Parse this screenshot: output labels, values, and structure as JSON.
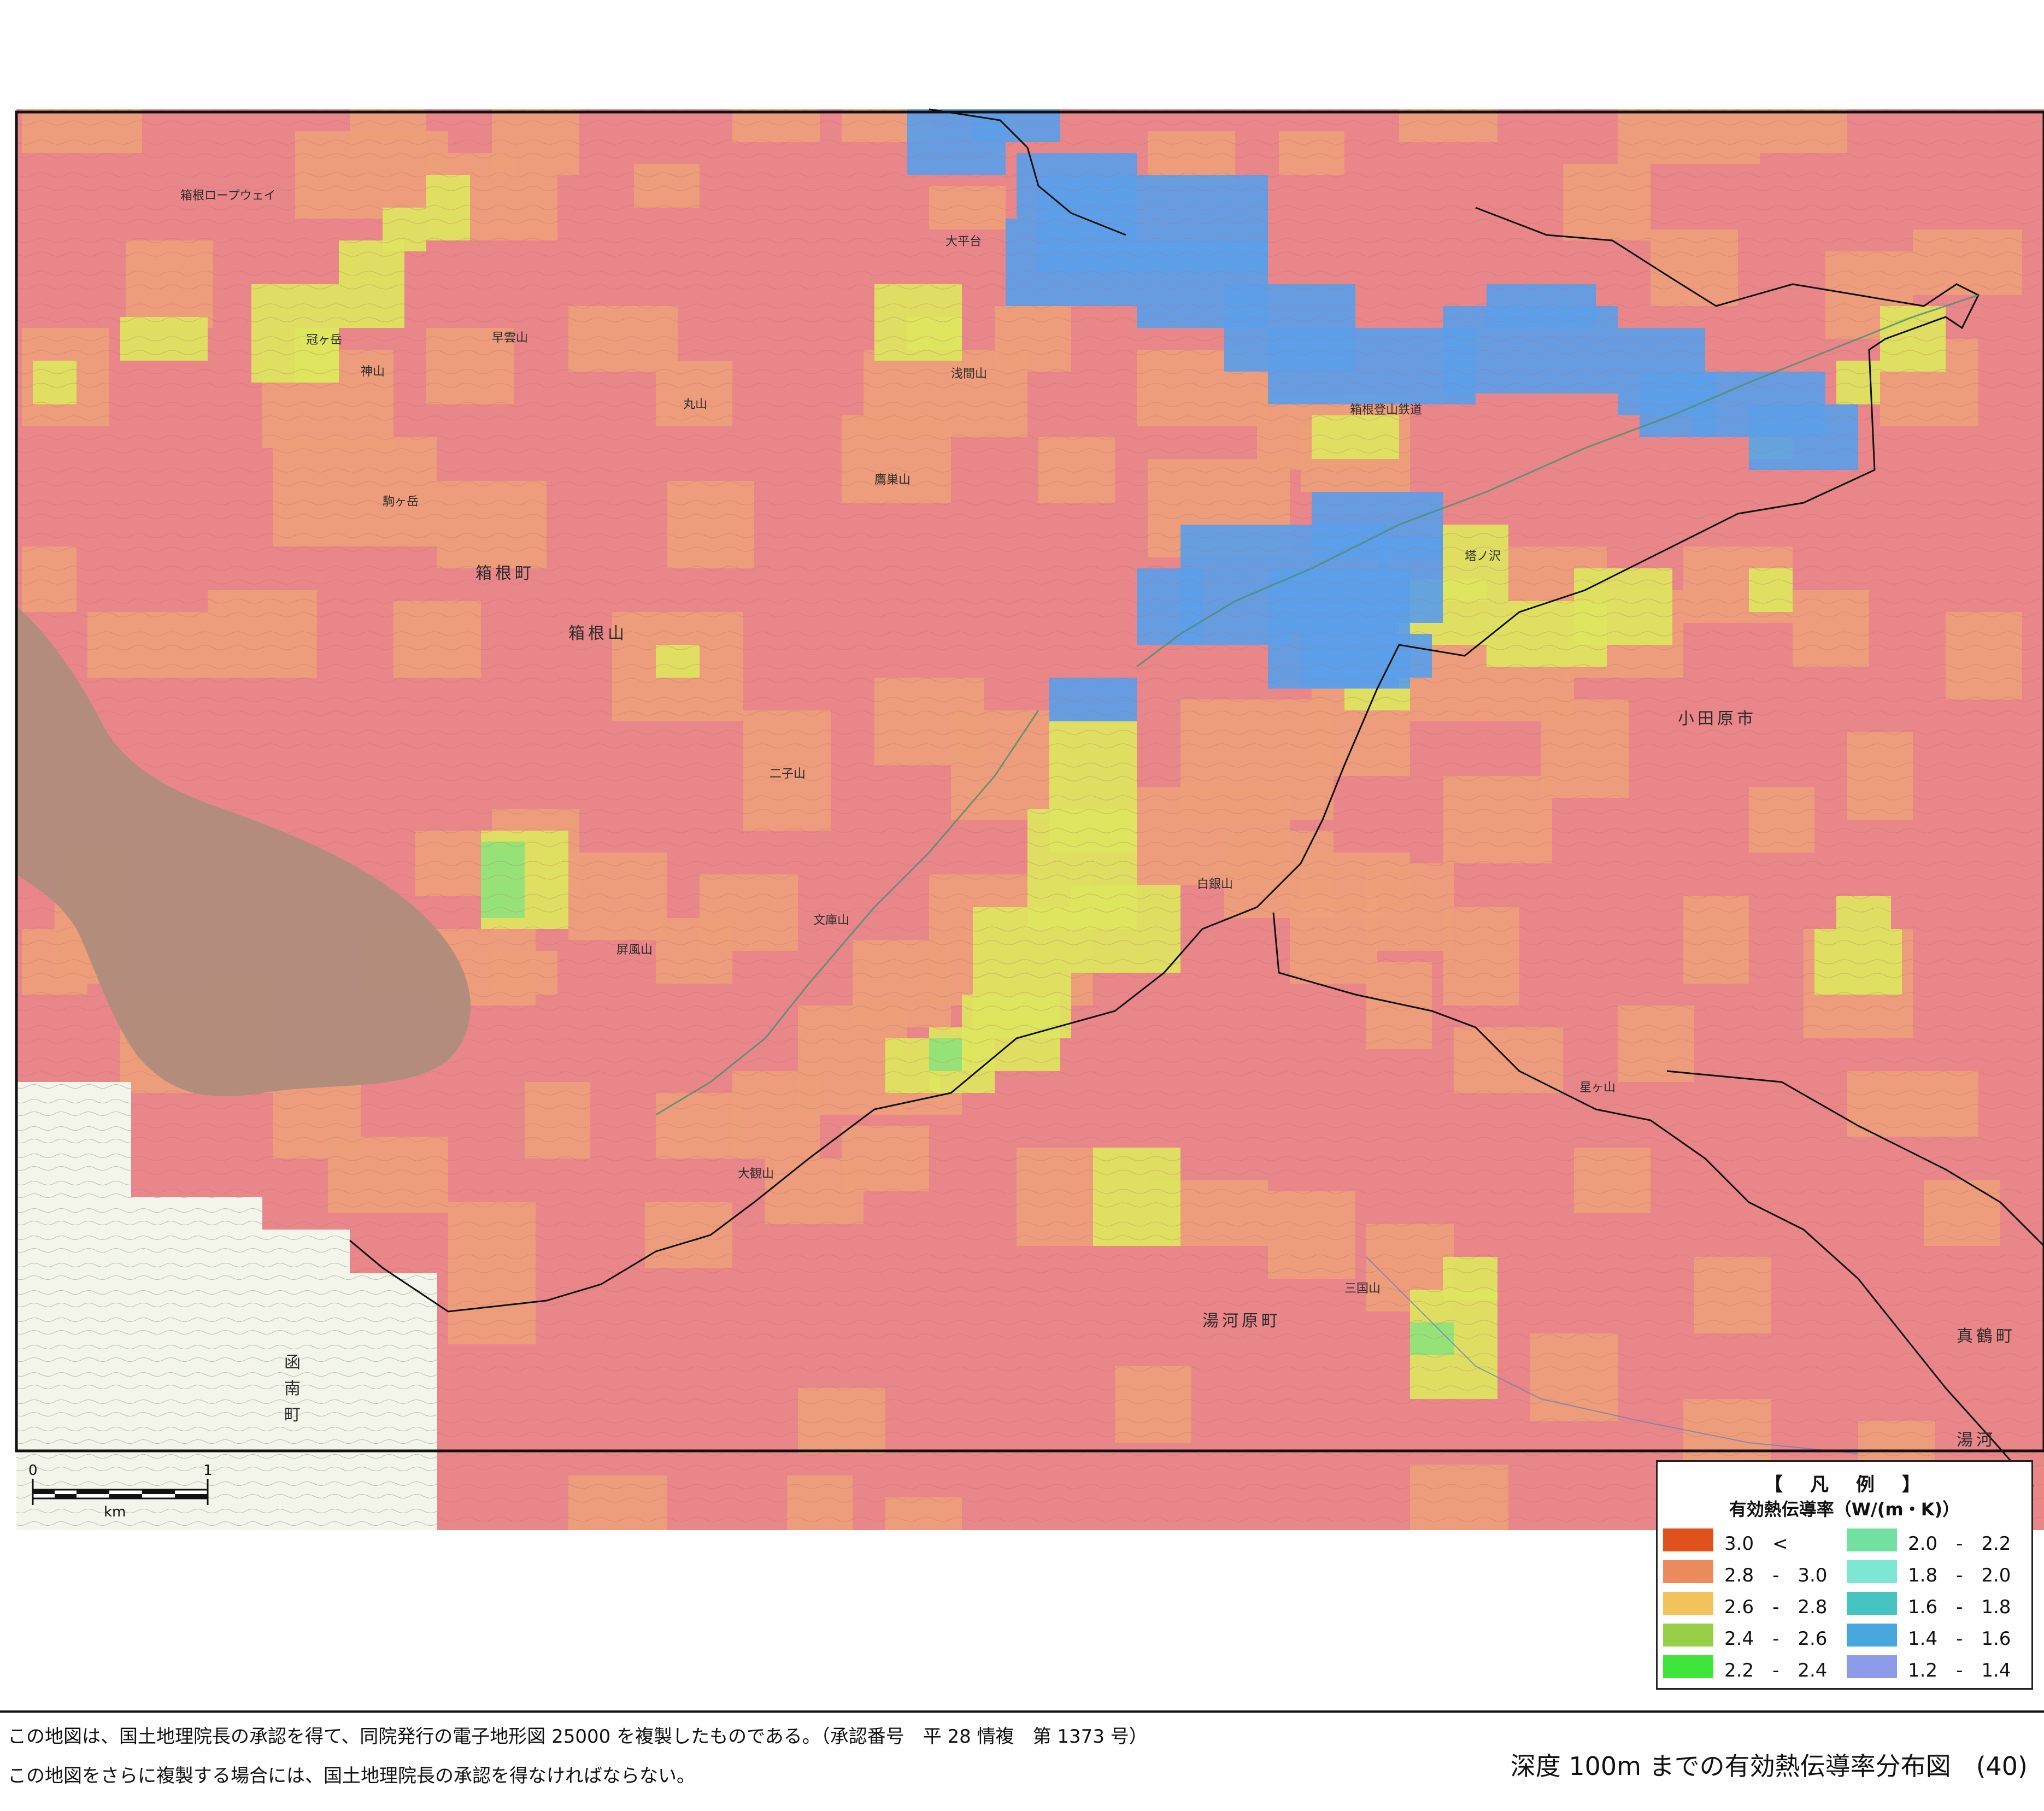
{
  "map": {
    "terrain_color": "#e8a9a1",
    "lake_color": "#b08c7c",
    "outside_color": "#f3f5ea"
  },
  "place_labels": {
    "hakone_town": "箱根町",
    "hakonesan": "箱根山",
    "odawara_city": "小田原市",
    "yugawara_town": "湯河原町",
    "kannami_town": "函南町",
    "manazuru": "真鶴町",
    "yugawara_edge": "湯河",
    "kamiyama": "神山",
    "byobuyama": "屏風山",
    "futagoyama": "二子山",
    "shirogane": "白銀山",
    "taikanzan": "大観山",
    "komagatake": "駒ヶ岳",
    "asama": "浅間山",
    "takanosuyama": "鷹巣山",
    "mikuni": "三国山",
    "tonosawa": "塔ノ沢",
    "ropeway": "箱根ロープウェイ",
    "tozan_railway": "箱根登山鉄道",
    "maruyama": "丸山",
    "kanmurigatake": "冠ヶ岳",
    "sounzan": "早雲山",
    "bunkozan": "文庫山",
    "hoshigayama": "星ヶ山",
    "ohira": "大平台"
  },
  "scale": {
    "zero": "0",
    "one": "1",
    "unit": "km"
  },
  "legend": {
    "title": "【　凡　例　】",
    "subtitle": "有効熱伝導率（W/(m・K)）",
    "items": [
      {
        "label": "3.0　<",
        "color": "#e0521b"
      },
      {
        "label": "2.8　-　3.0",
        "color": "#ec8c5e"
      },
      {
        "label": "2.6　-　2.8",
        "color": "#f2c35a"
      },
      {
        "label": "2.4　-　2.6",
        "color": "#97cf47"
      },
      {
        "label": "2.2　-　2.4",
        "color": "#3fe53a"
      },
      {
        "label": "2.0　-　2.2",
        "color": "#72e0a1"
      },
      {
        "label": "1.8　-　2.0",
        "color": "#7ee6d2"
      },
      {
        "label": "1.6　-　1.8",
        "color": "#46c4c2"
      },
      {
        "label": "1.4　-　1.6",
        "color": "#45a7db"
      },
      {
        "label": "1.2　-　1.4",
        "color": "#8d9ce8"
      }
    ]
  },
  "cell_colors": {
    "red": "#e9868a",
    "orange": "#eda07a",
    "yellow": "#dde55e",
    "green": "#8fe27a",
    "blue": "#5b9ee8"
  },
  "footer": {
    "note1": "この地図は、国土地理院長の承認を得て、同院発行の電子地形図 25000 を複製したものである。（承認番号　平 28 情複　第 1373 号）",
    "note2": "この地図をさらに複製する場合には、国土地理院長の承認を得なければならない。",
    "title": "深度 100m までの有効熱伝導率分布図　(40)"
  }
}
